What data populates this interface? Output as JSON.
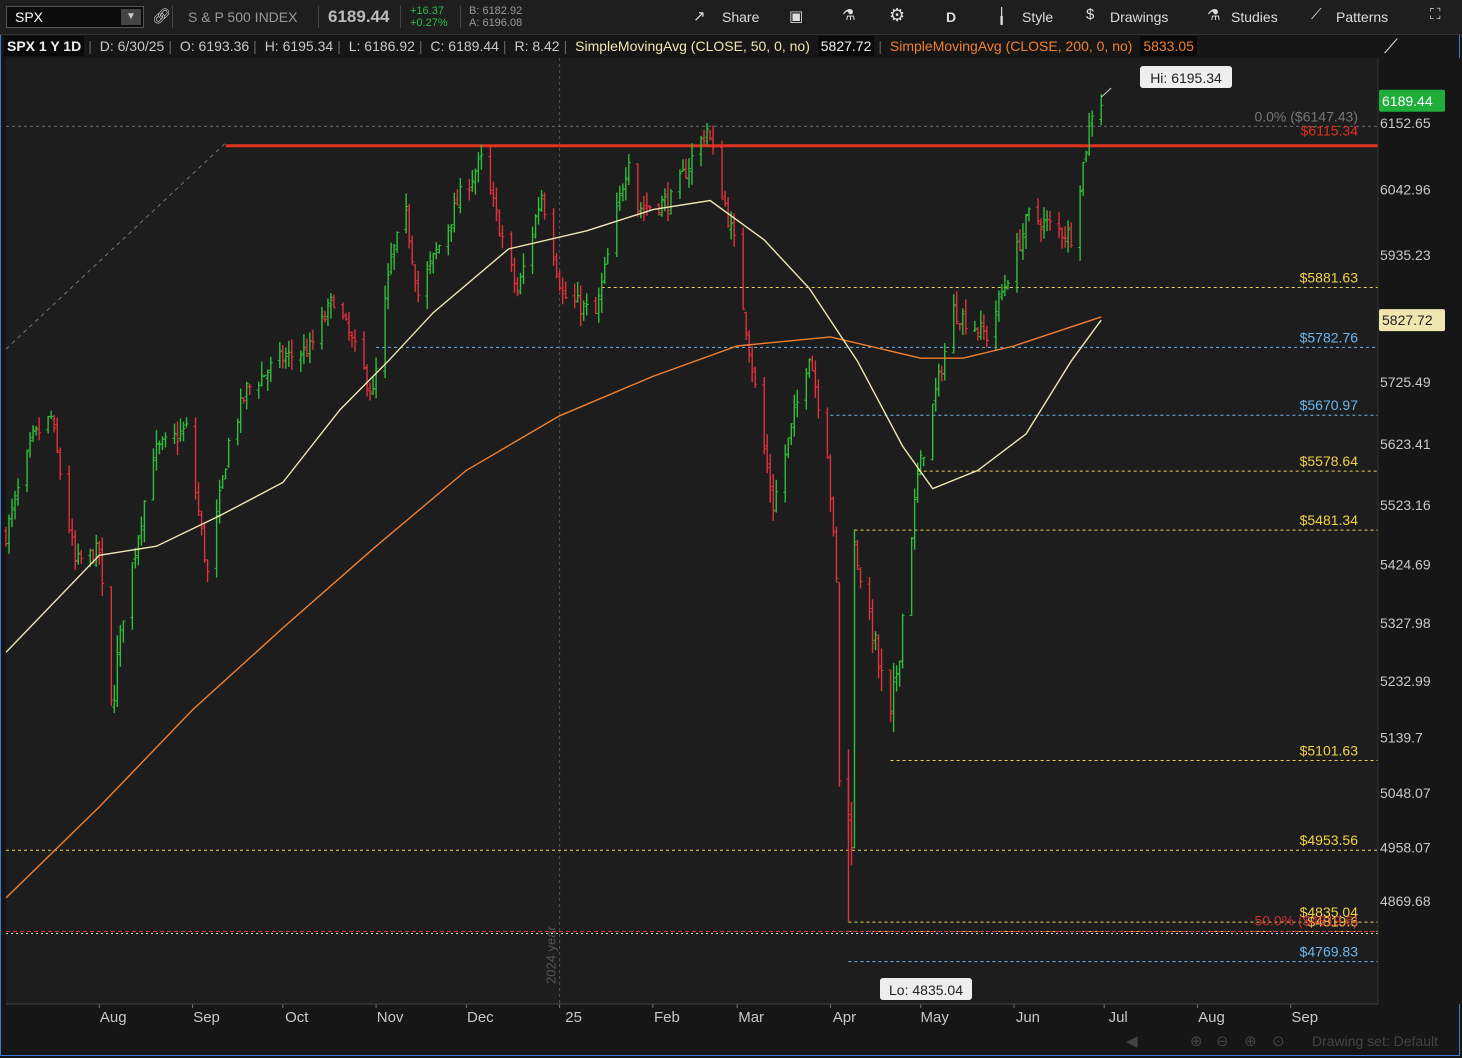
{
  "toolbar": {
    "symbol": "SPX",
    "symbol_name": "S & P 500 INDEX",
    "last": "6189.44",
    "change": "+16.37",
    "change_pct": "+0.27%",
    "bid": "B: 6182.92",
    "ask": "A: 6196.08",
    "share": "Share",
    "period": "D",
    "style": "Style",
    "drawings": "Drawings",
    "studies": "Studies",
    "patterns": "Patterns"
  },
  "infoline": {
    "title": "SPX 1 Y 1D",
    "date": "D: 6/30/25",
    "open": "O: 6193.36",
    "high": "H: 6195.34",
    "low": "L: 6186.92",
    "close": "C: 6189.44",
    "range": "R: 8.42",
    "ma50_label": "SimpleMovingAvg (CLOSE, 50, 0, no)",
    "ma50_value": "5827.72",
    "ma200_label": "SimpleMovingAvg (CLOSE, 200, 0, no)",
    "ma200_value": "5833.05"
  },
  "footer": {
    "drawing_set": "Drawing set: Default"
  },
  "colors": {
    "up": "#2fbf3a",
    "down": "#e0323c",
    "ma50": "#f0e6b0",
    "ma200": "#f08030",
    "resistance": "#e0321e",
    "level_yellow": "#f2d24a",
    "level_blue": "#6ab7f0"
  },
  "chart_data": {
    "type": "candlestick",
    "ylim": [
      4700,
      6260
    ],
    "y_ticks": [
      6152.65,
      6042.96,
      5935.23,
      5827.72,
      5725.49,
      5623.41,
      5523.16,
      5424.69,
      5327.98,
      5232.99,
      5139.7,
      5048.07,
      4958.07,
      4869.68
    ],
    "y_tick_labels": [
      "6152.65",
      "6042.96",
      "5935.23",
      "5827.72",
      "5725.49",
      "5623.41",
      "5523.16",
      "5424.69",
      "5327.98",
      "5232.99",
      "5139.7",
      "5048.07",
      "4958.07",
      "4869.68"
    ],
    "x_month_labels": [
      "Aug",
      "Sep",
      "Oct",
      "Nov",
      "Dec",
      "25",
      "Feb",
      "Mar",
      "Apr",
      "May",
      "Jun",
      "Jul",
      "Aug",
      "Sep"
    ],
    "x_start": "2024-07-01",
    "x_end": "2025-09-30",
    "year_marker": {
      "date": "2025-01-01",
      "label": "2024 year"
    },
    "last_price": 6189.44,
    "ma50_last": 5827.72,
    "high_label": "Hi: 6195.34",
    "low_label": "Lo: 4835.04",
    "high": {
      "date": "2025-06-30",
      "value": 6195.34
    },
    "low": {
      "date": "2025-04-07",
      "value": 4835.04
    },
    "resistance": {
      "value": 6115.34,
      "label": "$6115.34",
      "from": "2024-09-12"
    },
    "fib_top": {
      "value": 6147.43,
      "label": "0.0% ($6147.43)"
    },
    "fib_mid": {
      "value": 4819.6,
      "label": "50.0% ($4819.6)"
    },
    "levels": [
      {
        "value": 5881.63,
        "label": "$5881.63",
        "from": "2025-01-15",
        "color": "yellow"
      },
      {
        "value": 5782.76,
        "label": "$5782.76",
        "from": "2024-11-01",
        "color": "blue"
      },
      {
        "value": 5670.97,
        "label": "$5670.97",
        "from": "2025-04-01",
        "color": "blue"
      },
      {
        "value": 5578.64,
        "label": "$5578.64",
        "from": "2025-04-30",
        "color": "yellow"
      },
      {
        "value": 5481.34,
        "label": "$5481.34",
        "from": "2025-04-09",
        "color": "yellow"
      },
      {
        "value": 5101.63,
        "label": "$5101.63",
        "from": "2025-04-21",
        "color": "yellow"
      },
      {
        "value": 4953.56,
        "label": "$4953.56",
        "from": "2024-07-01",
        "color": "yellow"
      },
      {
        "value": 4835.04,
        "label": "$4835.04",
        "from": "2025-04-07",
        "color": "yellow"
      },
      {
        "value": 4819.6,
        "label": "$4819.6",
        "from": "2025-04-07",
        "color": "yellow"
      },
      {
        "value": 4769.83,
        "label": "$4769.83",
        "from": "2025-04-07",
        "color": "blue"
      }
    ],
    "close_path": [
      [
        "2024-07-01",
        5475
      ],
      [
        "2024-07-10",
        5633
      ],
      [
        "2024-07-16",
        5667
      ],
      [
        "2024-07-24",
        5427
      ],
      [
        "2024-08-01",
        5446
      ],
      [
        "2024-08-05",
        5186
      ],
      [
        "2024-08-09",
        5344
      ],
      [
        "2024-08-19",
        5608
      ],
      [
        "2024-08-30",
        5648
      ],
      [
        "2024-09-06",
        5408
      ],
      [
        "2024-09-13",
        5626
      ],
      [
        "2024-09-19",
        5713
      ],
      [
        "2024-09-30",
        5762
      ],
      [
        "2024-10-10",
        5780
      ],
      [
        "2024-10-18",
        5864
      ],
      [
        "2024-10-31",
        5705
      ],
      [
        "2024-11-06",
        5929
      ],
      [
        "2024-11-11",
        6001
      ],
      [
        "2024-11-15",
        5870
      ],
      [
        "2024-11-29",
        6032
      ],
      [
        "2024-12-06",
        6090
      ],
      [
        "2024-12-18",
        5872
      ],
      [
        "2024-12-26",
        6037
      ],
      [
        "2025-01-02",
        5868
      ],
      [
        "2025-01-13",
        5836
      ],
      [
        "2025-01-24",
        6101
      ],
      [
        "2025-01-27",
        6012
      ],
      [
        "2025-02-07",
        6025
      ],
      [
        "2025-02-19",
        6144
      ],
      [
        "2025-02-28",
        5955
      ],
      [
        "2025-03-10",
        5614
      ],
      [
        "2025-03-13",
        5521
      ],
      [
        "2025-03-25",
        5776
      ],
      [
        "2025-03-31",
        5612
      ],
      [
        "2025-04-03",
        5396
      ],
      [
        "2025-04-04",
        5074
      ],
      [
        "2025-04-08",
        4982
      ],
      [
        "2025-04-09",
        5456
      ],
      [
        "2025-04-21",
        5158
      ],
      [
        "2025-04-30",
        5569
      ],
      [
        "2025-05-12",
        5844
      ],
      [
        "2025-05-23",
        5802
      ],
      [
        "2025-06-06",
        6000
      ],
      [
        "2025-06-20",
        5967
      ],
      [
        "2025-06-27",
        6173
      ],
      [
        "2025-06-30",
        6189.44
      ]
    ],
    "ma50": [
      [
        "2024-07-01",
        5280
      ],
      [
        "2024-08-01",
        5440
      ],
      [
        "2024-08-20",
        5455
      ],
      [
        "2024-09-10",
        5505
      ],
      [
        "2024-10-01",
        5560
      ],
      [
        "2024-10-20",
        5680
      ],
      [
        "2024-11-05",
        5760
      ],
      [
        "2024-11-20",
        5840
      ],
      [
        "2024-12-15",
        5945
      ],
      [
        "2025-01-10",
        5975
      ],
      [
        "2025-02-01",
        6010
      ],
      [
        "2025-02-20",
        6025
      ],
      [
        "2025-03-10",
        5960
      ],
      [
        "2025-03-25",
        5880
      ],
      [
        "2025-04-10",
        5760
      ],
      [
        "2025-04-25",
        5620
      ],
      [
        "2025-05-05",
        5550
      ],
      [
        "2025-05-20",
        5580
      ],
      [
        "2025-06-05",
        5640
      ],
      [
        "2025-06-20",
        5760
      ],
      [
        "2025-06-30",
        5827.72
      ]
    ],
    "ma200": [
      [
        "2024-07-01",
        4875
      ],
      [
        "2024-08-01",
        5025
      ],
      [
        "2024-09-01",
        5185
      ],
      [
        "2024-10-01",
        5320
      ],
      [
        "2024-11-01",
        5455
      ],
      [
        "2024-12-01",
        5580
      ],
      [
        "2025-01-01",
        5670
      ],
      [
        "2025-02-01",
        5735
      ],
      [
        "2025-03-01",
        5785
      ],
      [
        "2025-04-01",
        5800
      ],
      [
        "2025-05-01",
        5765
      ],
      [
        "2025-05-15",
        5765
      ],
      [
        "2025-06-01",
        5785
      ],
      [
        "2025-06-30",
        5833.05
      ]
    ]
  }
}
